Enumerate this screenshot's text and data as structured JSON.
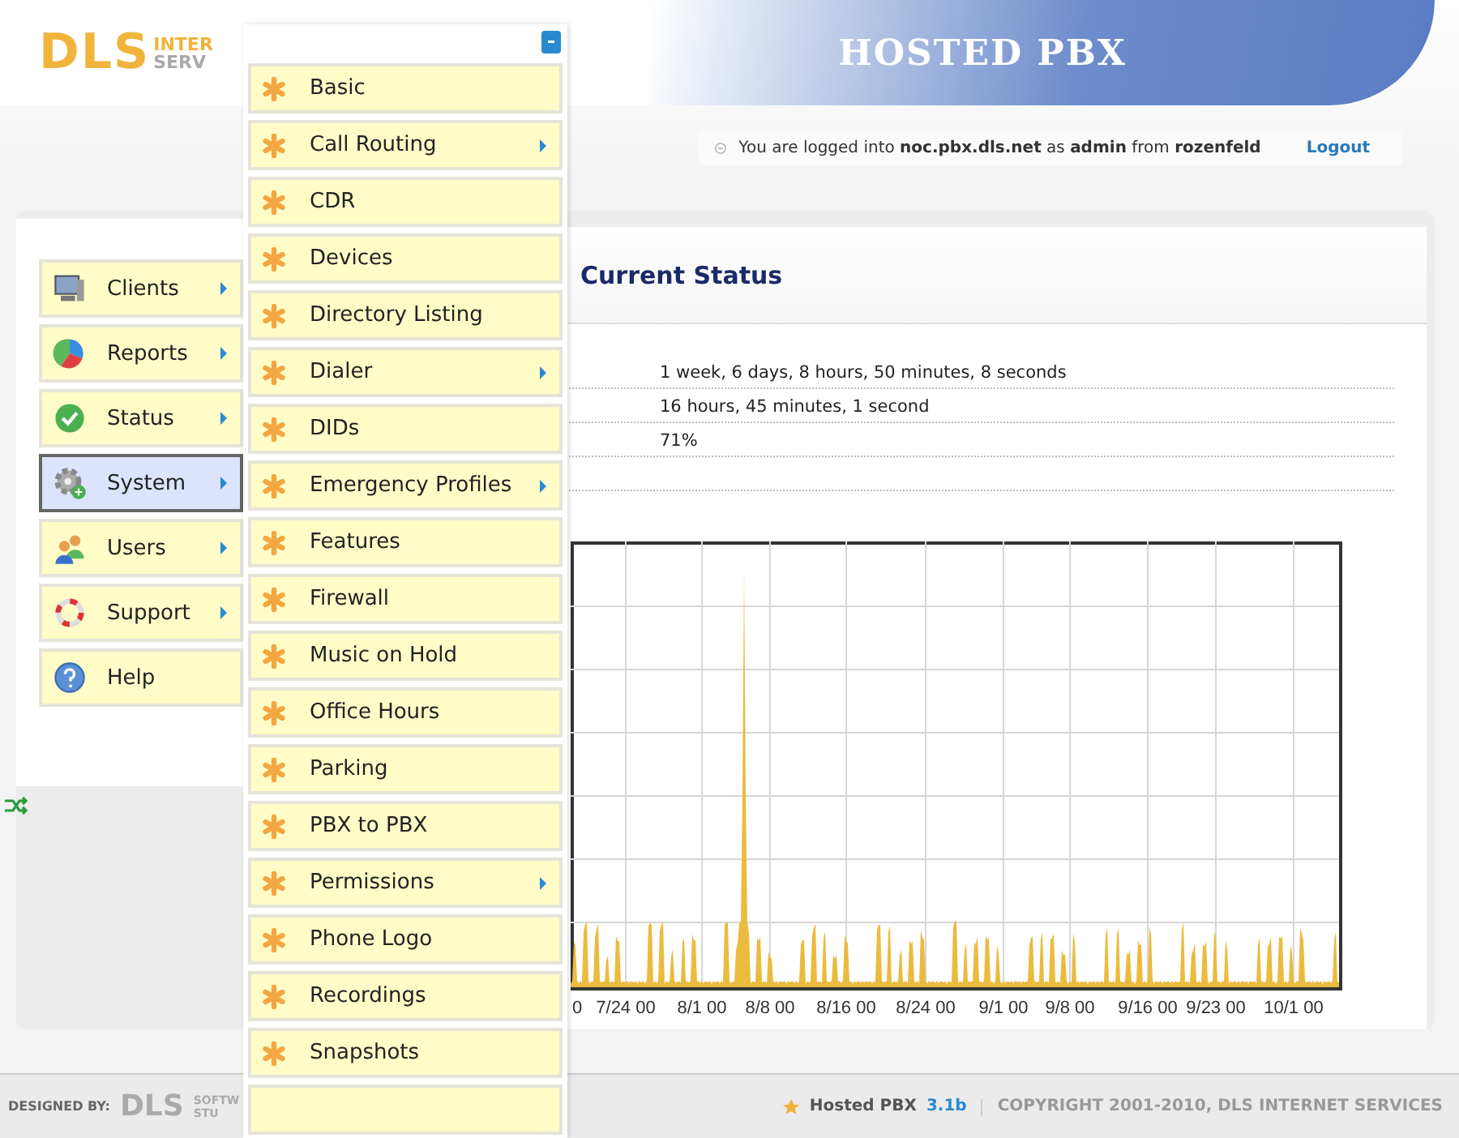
{
  "header": {
    "logo": "DLS",
    "logo_top": "INTER",
    "logo_bottom": "SERV",
    "title": "HOSTED PBX"
  },
  "login": {
    "message": "You are logged into **noc.pbx.dls.net** as **admin** from **rozenfeld**",
    "logout": "Logout"
  },
  "sidebar": {
    "items": [
      {
        "label": "Clients",
        "kind": "monitor",
        "has_submenu": true,
        "selected": false
      },
      {
        "label": "Reports",
        "kind": "pie",
        "has_submenu": true,
        "selected": false
      },
      {
        "label": "Status",
        "kind": "check",
        "has_submenu": true,
        "selected": false
      },
      {
        "label": "System",
        "kind": "gear",
        "has_submenu": true,
        "selected": true
      },
      {
        "label": "Users",
        "kind": "users",
        "has_submenu": true,
        "selected": false
      },
      {
        "label": "Support",
        "kind": "lifebuoy",
        "has_submenu": true,
        "selected": false
      },
      {
        "label": "Help",
        "kind": "help",
        "has_submenu": false,
        "selected": false
      }
    ]
  },
  "submenu": {
    "items": [
      {
        "label": "Basic",
        "has_submenu": false
      },
      {
        "label": "Call Routing",
        "has_submenu": true
      },
      {
        "label": "CDR",
        "has_submenu": false
      },
      {
        "label": "Devices",
        "has_submenu": false
      },
      {
        "label": "Directory Listing",
        "has_submenu": false
      },
      {
        "label": "Dialer",
        "has_submenu": true
      },
      {
        "label": "DIDs",
        "has_submenu": false
      },
      {
        "label": "Emergency Profiles",
        "has_submenu": true
      },
      {
        "label": "Features",
        "has_submenu": false
      },
      {
        "label": "Firewall",
        "has_submenu": false
      },
      {
        "label": "Music on Hold",
        "has_submenu": false
      },
      {
        "label": "Office Hours",
        "has_submenu": false
      },
      {
        "label": "Parking",
        "has_submenu": false
      },
      {
        "label": "PBX to PBX",
        "has_submenu": false
      },
      {
        "label": "Permissions",
        "has_submenu": true
      },
      {
        "label": "Phone Logo",
        "has_submenu": false
      },
      {
        "label": "Recordings",
        "has_submenu": false
      },
      {
        "label": "Snapshots",
        "has_submenu": false
      }
    ]
  },
  "status": {
    "title": "Current Status",
    "values": [
      "1 week, 6 days, 8 hours, 50 minutes, 8 seconds",
      "16 hours, 45 minutes, 1 second",
      "71%"
    ],
    "chart": {
      "x_labels": [
        "0",
        "7/24 00",
        "8/1 00",
        "8/8 00",
        "8/16 00",
        "8/24 00",
        "9/1 00",
        "9/8 00",
        "9/16 00",
        "9/23 00",
        "10/1 00"
      ]
    }
  },
  "footer": {
    "designed_by": "DESIGNED BY:",
    "logo": "DLS",
    "logo_top": "SOFTW",
    "logo_bottom": "STU",
    "product": "Hosted PBX",
    "version": "3.1b",
    "copyright": "COPYRIGHT 2001-2010, DLS INTERNET SERVICES"
  }
}
